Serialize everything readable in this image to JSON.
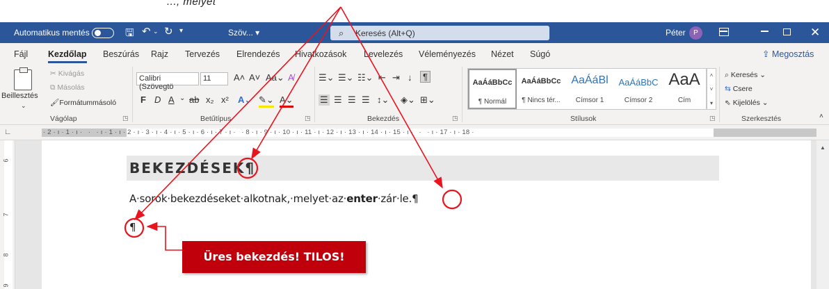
{
  "top_cut_text": "..., melyet",
  "titlebar": {
    "autosave_label": "Automatikus mentés",
    "save_icon": "floppy-icon",
    "undo_icon": "undo-icon",
    "redo_icon": "redo-icon",
    "doc_name": "Szöv... ▾",
    "search_placeholder": "Keresés (Alt+Q)",
    "user_name": "Péter",
    "avatar_initial": "P",
    "theme_color": "#2b579a"
  },
  "tabs": [
    "Fájl",
    "Kezdőlap",
    "Beszúrás",
    "Rajz",
    "Tervezés",
    "Elrendezés",
    "Hivatkozások",
    "Levelezés",
    "Véleményezés",
    "Nézet",
    "Súgó"
  ],
  "active_tab": "Kezdőlap",
  "share_label": "Megosztás",
  "ribbon": {
    "clipboard": {
      "label": "Vágólap",
      "paste": "Beillesztés",
      "cut": "Kivágás",
      "copy": "Másolás",
      "format_painter": "Formátummásoló"
    },
    "font": {
      "label": "Betűtípus",
      "font_name": "Calibri (Szövegtö",
      "font_size": "11",
      "bold": "F",
      "italic": "D",
      "underline": "A"
    },
    "paragraph": {
      "label": "Bekezdés"
    },
    "styles": {
      "label": "Stílusok",
      "items": [
        {
          "preview": "AaÁáBbCc",
          "name": "¶ Normál"
        },
        {
          "preview": "AaÁáBbCc",
          "name": "¶ Nincs tér..."
        },
        {
          "preview": "AaÁáBl",
          "name": "Címsor 1"
        },
        {
          "preview": "AaÁáBbC",
          "name": "Címsor 2"
        },
        {
          "preview": "AaA",
          "name": "Cím"
        }
      ]
    },
    "editing": {
      "label": "Szerkesztés",
      "find": "Keresés",
      "replace": "Csere",
      "select": "Kijelölés"
    }
  },
  "ruler_numbers": "· 2 · ı · 1 · ı ·   ·   · ı · 1 · ı · 2 · ı · 3 · ı · 4 · ı · 5 · ı · 6 · ı · 7 · ı ·   · 8 · ı · 9 · ı · 10 · ı · 11 · ı · 12 · ı · 13 · ı · 14 · ı · 15 · ı ·   ·   · ı · 17 · ı · 18 ·",
  "vruler_numbers": [
    "6",
    "7",
    "8",
    "9"
  ],
  "document": {
    "heading": "BEKEZDÉSEK¶",
    "para_before": "A·sorok·bekezdéseket·alkotnak,·melyet·az·",
    "para_bold": "enter",
    "para_after": "·zár·le.¶",
    "empty_para": "¶"
  },
  "callout_text": "Üres bekezdés! TILOS!",
  "annotation_color": "#e8141e"
}
